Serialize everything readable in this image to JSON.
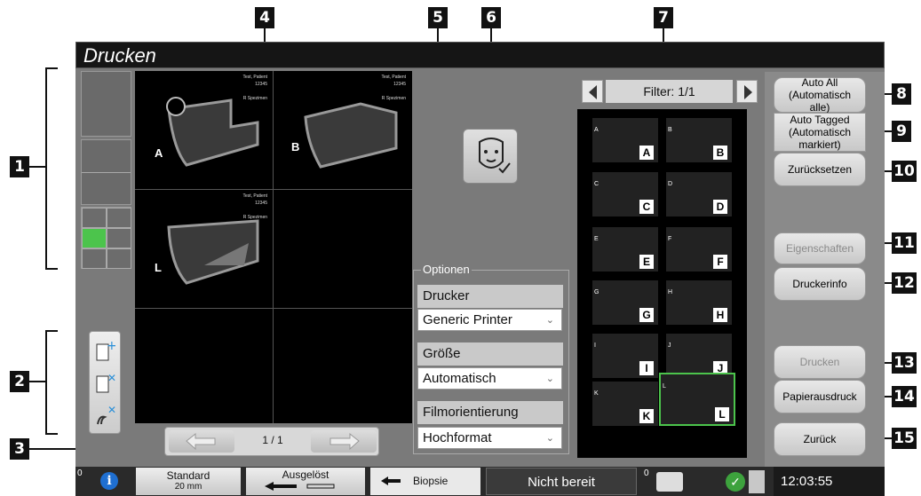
{
  "window_title": "Drucken",
  "callouts": [
    "1",
    "2",
    "3",
    "4",
    "5",
    "6",
    "7",
    "8",
    "9",
    "10",
    "11",
    "12",
    "13",
    "14",
    "15"
  ],
  "preview": {
    "patient_name": "Test, Patient",
    "patient_id": "12345",
    "spacer": "R Spezimen",
    "view_letters": [
      "A",
      "B",
      "L"
    ]
  },
  "paging": {
    "page": "1 / 1"
  },
  "options": {
    "group_label": "Optionen",
    "printer_label": "Drucker",
    "printer_value": "Generic Printer",
    "size_label": "Größe",
    "size_value": "Automatisch",
    "orientation_label": "Filmorientierung",
    "orientation_value": "Hochformat"
  },
  "filter": {
    "label": "Filter: 1/1"
  },
  "tiles": [
    {
      "letter": "A",
      "small": "A"
    },
    {
      "letter": "B",
      "small": "B"
    },
    {
      "letter": "C",
      "small": "C"
    },
    {
      "letter": "D",
      "small": "D"
    },
    {
      "letter": "E",
      "small": "E"
    },
    {
      "letter": "F",
      "small": "F"
    },
    {
      "letter": "G",
      "small": "G"
    },
    {
      "letter": "H",
      "small": "H"
    },
    {
      "letter": "I",
      "small": "I"
    },
    {
      "letter": "J",
      "small": "J"
    },
    {
      "letter": "K",
      "small": "K"
    },
    {
      "letter": "L",
      "small": "L"
    }
  ],
  "buttons": {
    "auto_all": "Auto All (Automatisch alle)",
    "auto_tagged": "Auto Tagged (Automatisch markiert)",
    "reset": "Zurücksetzen",
    "properties": "Eigenschaften",
    "printer_info": "Druckerinfo",
    "print": "Drucken",
    "paper_print": "Papierausdruck",
    "back": "Zurück"
  },
  "statusbar": {
    "count_left": "0",
    "standard_title": "Standard",
    "standard_value": "20 mm",
    "released": "Ausgelöst",
    "biopsy": "Biopsie",
    "not_ready": "Nicht bereit",
    "count_right": "0",
    "time": "12:03:55"
  },
  "colors": {
    "selected_cell": "#4cc44c",
    "tile_selected_border": "#4cc44c"
  }
}
